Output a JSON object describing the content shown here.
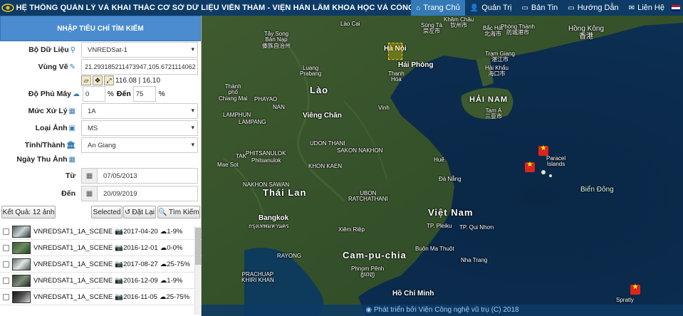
{
  "header": {
    "title": "HỆ THỐNG QUẢN LÝ VÀ KHAI THÁC CƠ SỞ DỮ LIỆU VIỄN THÁM - VIỆN HÀN LÂM KHOA HỌC VÀ CÔNG NGHỆ VIỆT NAM",
    "nav": [
      {
        "label": "Trang Chủ",
        "icon": "home-icon",
        "active": true
      },
      {
        "label": "Quản Trị",
        "icon": "user-icon"
      },
      {
        "label": "Bản Tin",
        "icon": "document-icon"
      },
      {
        "label": "Hướng Dẫn",
        "icon": "document-icon"
      },
      {
        "label": "Liên Hệ",
        "icon": "envelope-icon"
      }
    ]
  },
  "panel": {
    "title": "NHẬP TIÊU CHÍ TÌM KIẾM",
    "dataset_label": "Bộ Dữ Liệu",
    "dataset_value": "VNREDSat-1",
    "area_label": "Vùng Vẽ",
    "area_value": "21.293185211473947,105.6721114062",
    "area_size": "116.08 | 16.10",
    "cloud_label": "Độ Phủ Mây",
    "cloud_from": "0",
    "cloud_unit": "%",
    "cloud_to_label": "Đến",
    "cloud_to": "75",
    "level_label": "Mức Xử Lý",
    "level_value": "1A",
    "image_type_label": "Loại Ảnh",
    "image_type_value": "MS",
    "province_label": "Tỉnh/Thành",
    "province_value": "An Giang",
    "date_label": "Ngày Thu Ảnh",
    "from_label": "Từ",
    "from_value": "07/05/2013",
    "to_label": "Đến",
    "to_value": "20/09/2019",
    "result_count": "Kết Quả: 12 ảnh",
    "selected_btn": "Selected",
    "reset_btn": "Đặt Lại",
    "search_btn": "Tìm Kiếm"
  },
  "results": [
    {
      "name": "VNREDSAT1_1A_SCENE",
      "date": "2017-04-20",
      "cloud": "1-9%"
    },
    {
      "name": "VNREDSAT1_1A_SCENE",
      "date": "2016-12-01",
      "cloud": "0-0%"
    },
    {
      "name": "VNREDSAT1_1A_SCENE",
      "date": "2017-08-27",
      "cloud": "25-75%"
    },
    {
      "name": "VNREDSAT1_1A_SCENE",
      "date": "2016-12-09",
      "cloud": "1-9%"
    },
    {
      "name": "VNREDSAT1_1A_SCENE",
      "date": "2016-11-05",
      "cloud": "25-75%"
    }
  ],
  "map": {
    "labels": {
      "lao_cai": "Lào Cai",
      "sung_ta": "Sùng Tà\n崇左市",
      "khamchau": "Khâm Châu\n钦州市",
      "bac_hai": "Bắc Hải\n北海市",
      "phong_thanh": "Phòng Thành\n防城港市",
      "hong_kong": "Hồng Kông\n香港",
      "tay_song": "Tây Song\nBản Nạp\n傣族自治州",
      "ha_noi": "Hà Nội",
      "hai_phong": "Hải Phòng",
      "thanh_hoa": "Thanh\nHóa",
      "tram_giang": "Trạm Giang\n湛江市",
      "hai_khau": "Hải Khẩu\n海口市",
      "luang_prabang": "Luang\nPrabang",
      "lao": "Lào",
      "vinh": "Vinh",
      "hai_nam": "HẢI NAM",
      "tam_a": "Tam Á\n三亚市",
      "thanh_pho_chiang_mai": "Thành\nphố\nChiang Mai",
      "phayao": "PHAYAO",
      "nan": "NAN",
      "lamphun": "LAMPHUN",
      "lampang": "LAMPANG",
      "vieng_chan": "Viêng Chăn",
      "udon": "UDON THANI",
      "sakon": "SAKON NAKHON",
      "hue": "Huế",
      "paracel": "Paracel\nIslands",
      "phitsanulok": "PHITSANULOK",
      "tak": "TAK",
      "mae_sot": "Mae Sot",
      "phitsanulok_city": "Phitsanulok",
      "khon_kaen": "KHON KAEN",
      "da_nang": "Đà Nẵng",
      "bien_dong": "Biển Đông",
      "nakhon_sawan": "NAKHON SAWAN",
      "thai_lan": "Thái Lan",
      "ubon": "UBON\nRATCHATHANI",
      "viet_nam": "Việt Nam",
      "tp_pleiku": "TP. Pleiku",
      "tp_qui_nhon": "TP. Qui Nhơn",
      "bangkok": "Bangkok",
      "krung_thep": "กรุงเทพมหานคร",
      "xiem_riep": "Xiêm Riệp",
      "rayong": "RAYONG",
      "buon_ma_thuot": "Buôn Ma Thuột",
      "nha_trang": "Nha Trang",
      "campuchia": "Cam-pu-chia",
      "phnom_penh": "Phnom Pênh\nភ្នំពេញ",
      "prachuap": "PRACHUAP\nKHIRI KHAN",
      "ho_chi_minh": "Hồ Chí Minh",
      "spratly": "Spratly"
    }
  },
  "footer": "Phát triển bởi Viện Công nghệ vũ trụ (C) 2018"
}
